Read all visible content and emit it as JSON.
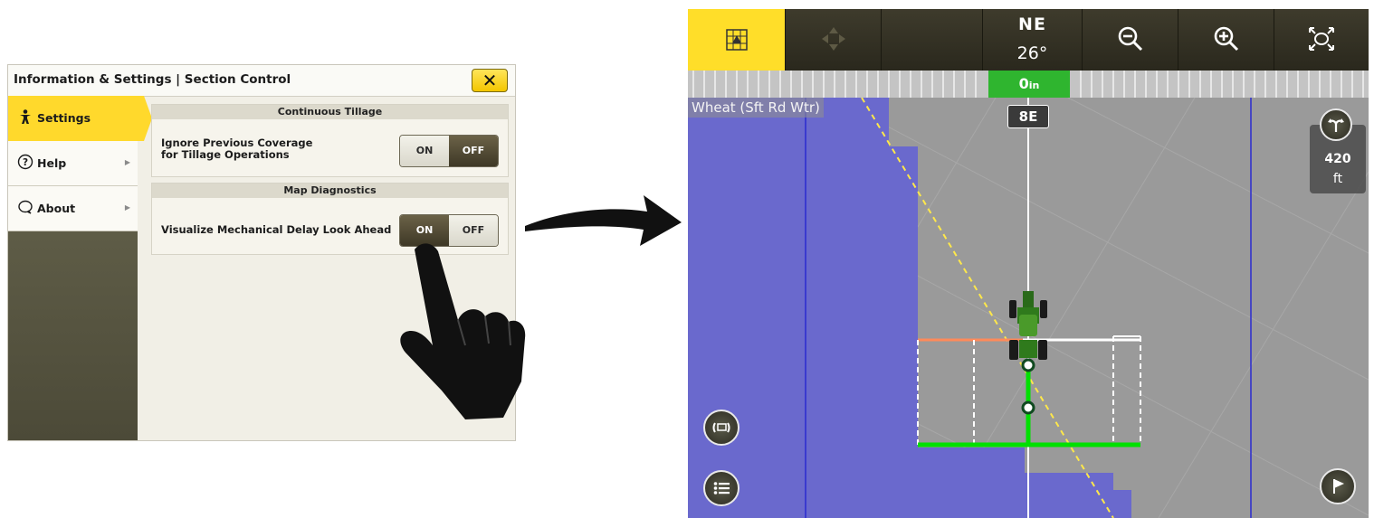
{
  "settings_panel": {
    "title": "Information & Settings | Section Control",
    "close_icon": "close-x-icon",
    "sidebar": [
      {
        "label": "Settings",
        "icon": "settings-person-icon",
        "active": true
      },
      {
        "label": "Help",
        "icon": "help-circle-icon",
        "active": false
      },
      {
        "label": "About",
        "icon": "about-chat-icon",
        "active": false
      }
    ],
    "sections": [
      {
        "title": "Continuous Tillage",
        "row_label_line1": "Ignore Previous Coverage",
        "row_label_line2": "for Tillage Operations",
        "on_label": "ON",
        "off_label": "OFF",
        "selected": "OFF"
      },
      {
        "title": "Map Diagnostics",
        "row_label": "Visualize Mechanical Delay Look Ahead",
        "on_label": "ON",
        "off_label": "OFF",
        "selected": "ON"
      }
    ]
  },
  "map": {
    "heading_direction": "NE",
    "heading_degrees": "26°",
    "offset": "0in",
    "offset_value": "0",
    "offset_unit": "in",
    "crop_label": "Wheat (Sft Rd Wtr)",
    "track_label": "8E",
    "distance_value": "420",
    "distance_unit": "ft",
    "toolbar_icons": [
      "map-view-icon",
      "pan-icon",
      "blank",
      "heading",
      "zoom-out-icon",
      "zoom-in-icon",
      "fit-extents-icon"
    ],
    "colors": {
      "coverage": "#6a69cd",
      "unapplied": "#9a9a9a",
      "guidance": "#ffffff",
      "look_ahead": "#00e000",
      "active_button": "#ffde29"
    }
  }
}
